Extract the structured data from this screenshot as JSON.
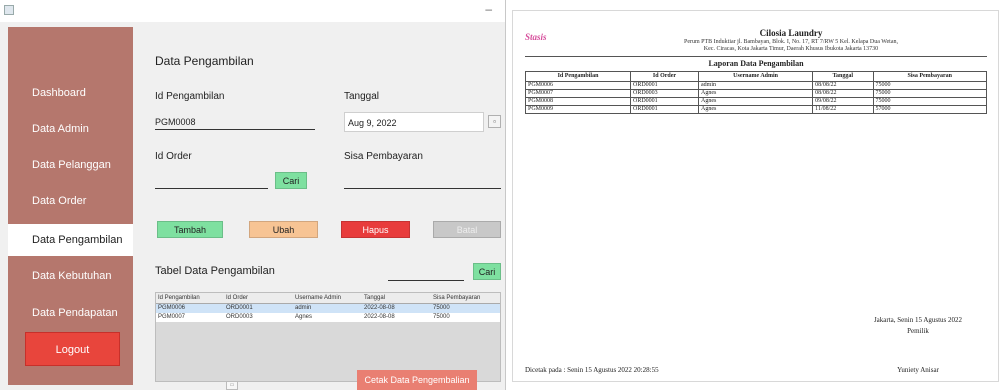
{
  "sidebar": {
    "items": [
      {
        "label": "Dashboard"
      },
      {
        "label": "Data Admin"
      },
      {
        "label": "Data Pelanggan"
      },
      {
        "label": "Data Order"
      },
      {
        "label": "Data Pengambilan"
      },
      {
        "label": "Data Kebutuhan"
      },
      {
        "label": "Data Pendapatan"
      }
    ],
    "logout": "Logout"
  },
  "form": {
    "title": "Data Pengambilan",
    "id_label": "Id Pengambilan",
    "id_value": "PGM0008",
    "date_label": "Tanggal",
    "date_value": "Aug 9, 2022",
    "order_label": "Id Order",
    "order_value": "",
    "cari_order": "Cari",
    "sisa_label": "Sisa Pembayaran",
    "sisa_value": ""
  },
  "actions": {
    "tambah": "Tambah",
    "ubah": "Ubah",
    "hapus": "Hapus",
    "batal": "Batal"
  },
  "colors": {
    "tambah": "#7ee0a0",
    "ubah": "#f7c494",
    "hapus": "#e83c3c",
    "batal": "#c8c8c8",
    "sidebar": "#b5776d",
    "logout": "#e8453c"
  },
  "table_section": {
    "title": "Tabel Data Pengambilan",
    "search_value": "",
    "cari": "Cari",
    "headers": [
      "Id Pengambilan",
      "Id Order",
      "Username Admin",
      "Tanggal",
      "Sisa Pembayaran"
    ],
    "rows": [
      [
        "PGM0006",
        "ORD0001",
        "admin",
        "2022-08-08",
        "75000"
      ],
      [
        "PGM0007",
        "ORD0003",
        "Agnes",
        "2022-08-08",
        "75000"
      ]
    ]
  },
  "print_button": "Cetak Data Pengembalian",
  "report": {
    "logo": "Stasis",
    "company": "Cilosia Laundry",
    "address_line1": "Perum PTB Induktiar jl. Bambayan, Blok. I, No. 17, RT 7/RW 5 Kel. Kelapa Dua Wetan,",
    "address_line2": "Kec. Ciracas, Kota Jakarta Timur, Daerah Khusus Ibukota Jakarta 13730",
    "title": "Laporan Data Pengambilan",
    "headers": [
      "Id Pengambilan",
      "Id Order",
      "Username Admin",
      "Tanggal",
      "Sisa Pembayaran"
    ],
    "rows": [
      [
        "PGM0006",
        "ORD0001",
        "admin",
        "08/08/22",
        "75000"
      ],
      [
        "PGM0007",
        "ORD0003",
        "Agnes",
        "08/08/22",
        "75000"
      ],
      [
        "PGM0008",
        "ORD0001",
        "Agnes",
        "09/08/22",
        "75000"
      ],
      [
        "PGM0009",
        "ORD0001",
        "Agnes",
        "11/08/22",
        "57000"
      ]
    ],
    "place_date": "Jakarta, Senin 15 Agustus 2022",
    "signer_role": "Pemilik",
    "printed_at": "Dicetak pada : Senin 15 Agustus 2022 20:28:55",
    "signer_name": "Yuniety Anisar"
  }
}
